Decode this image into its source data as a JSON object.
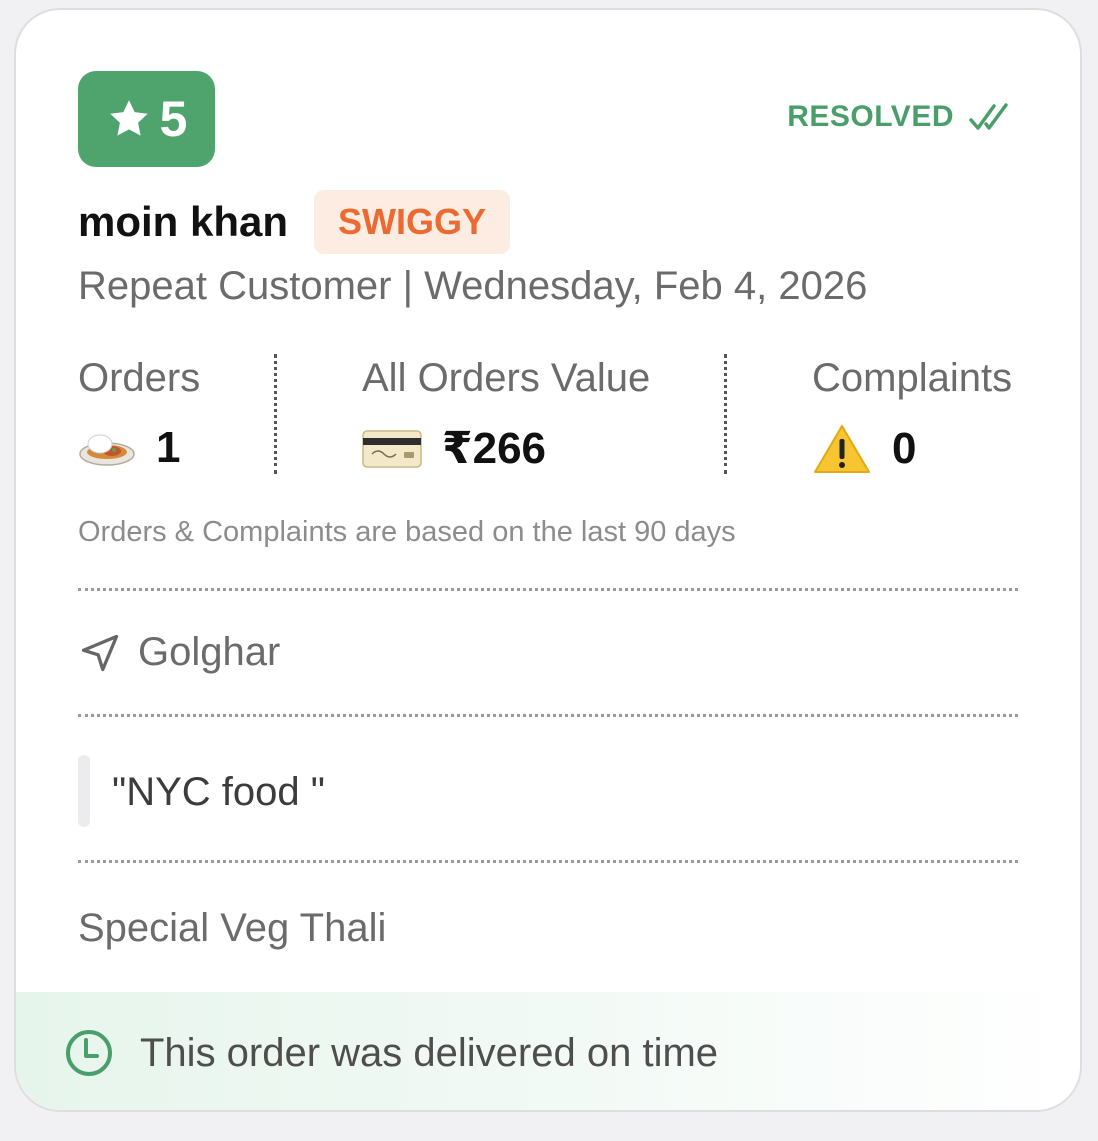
{
  "rating": {
    "value": "5",
    "icon": "star-icon",
    "color": "#4fa36d"
  },
  "status": {
    "label": "RESOLVED",
    "icon": "double-check-icon",
    "color": "#4a9e6a"
  },
  "customer": {
    "name": "moin khan",
    "platform": "SWIGGY",
    "platform_color": "#eb6a32",
    "subtitle": "Repeat Customer | Wednesday, Feb 4, 2026"
  },
  "stats": {
    "orders": {
      "label": "Orders",
      "value": "1",
      "icon": "rice-plate-icon"
    },
    "value": {
      "label": "All Orders Value",
      "value": "₹266",
      "icon": "credit-card-icon"
    },
    "complaints": {
      "label": "Complaints",
      "value": "0",
      "icon": "warning-icon"
    }
  },
  "note": "Orders & Complaints are based on the last 90 days",
  "location": {
    "text": "Golghar",
    "icon": "navigation-arrow-icon"
  },
  "comment": "\"NYC food \"",
  "item": "Special Veg Thali",
  "footer": {
    "text": "This order was delivered on time",
    "icon": "clock-icon"
  }
}
